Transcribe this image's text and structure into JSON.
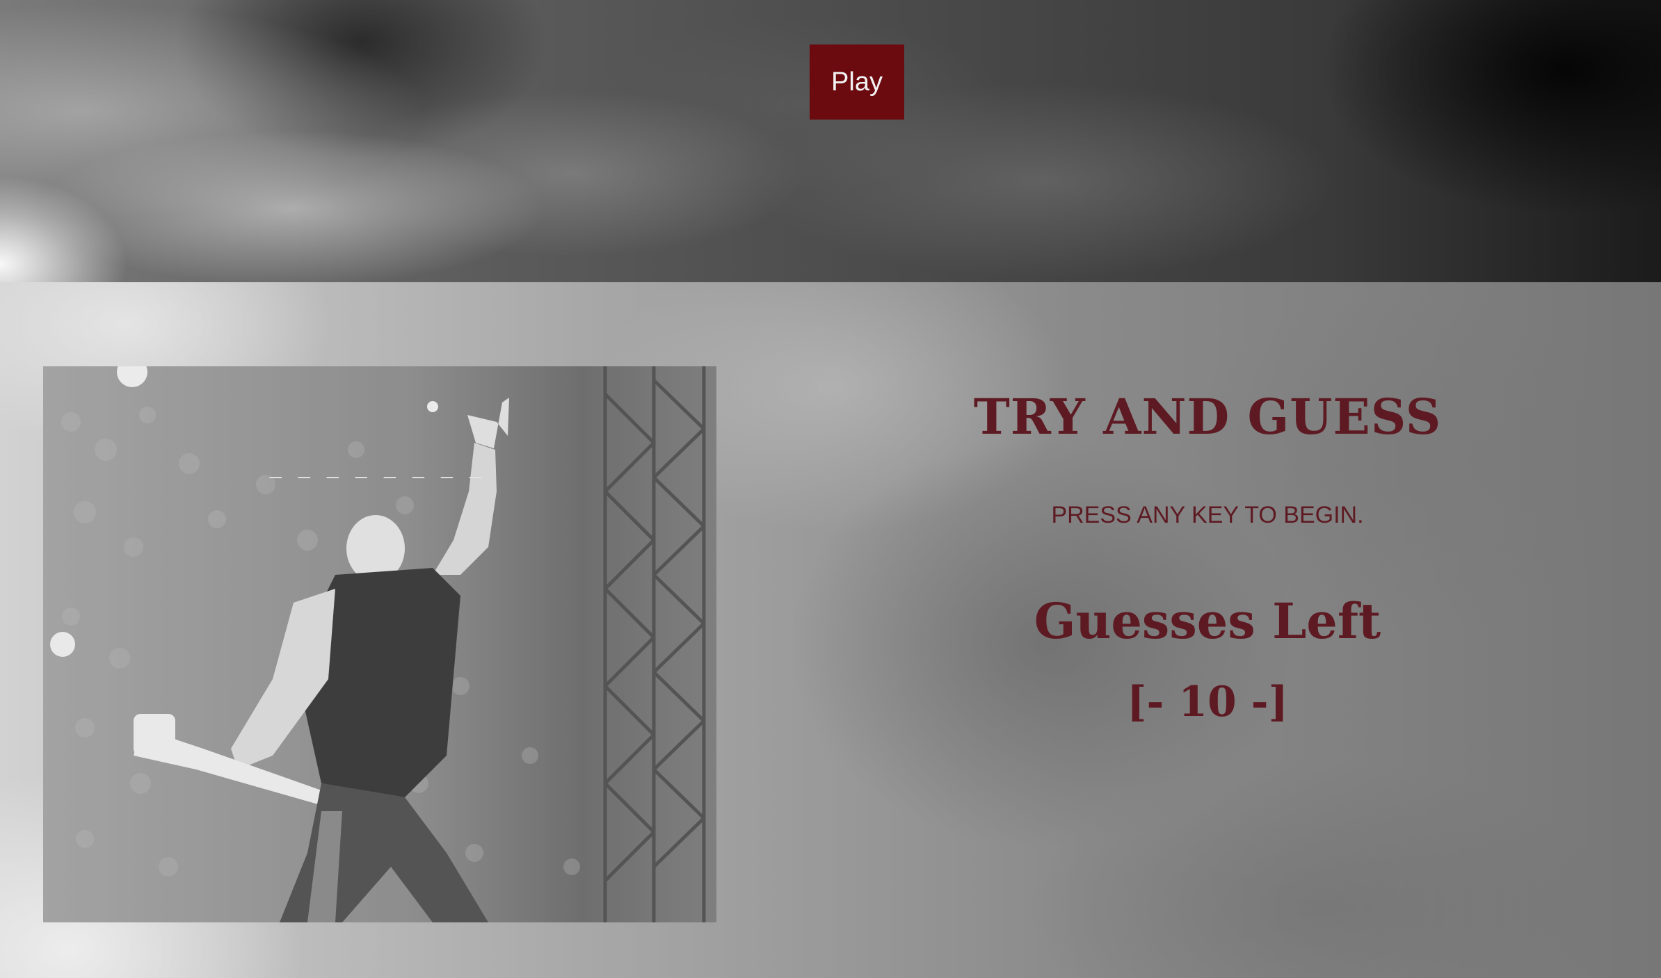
{
  "header": {
    "play_label": "Play"
  },
  "game": {
    "word_blanks": "_ _ _ _ _ _ _ _",
    "title": "TRY AND GUESS",
    "instruction": "PRESS ANY KEY TO BEGIN.",
    "guesses_label": "Guesses Left",
    "guesses_left": "[- 10 -]"
  },
  "colors": {
    "accent": "#6b0a0f",
    "text": "#5e1a22"
  },
  "icons": {
    "hero_image": "concert-guitarist-photo"
  }
}
